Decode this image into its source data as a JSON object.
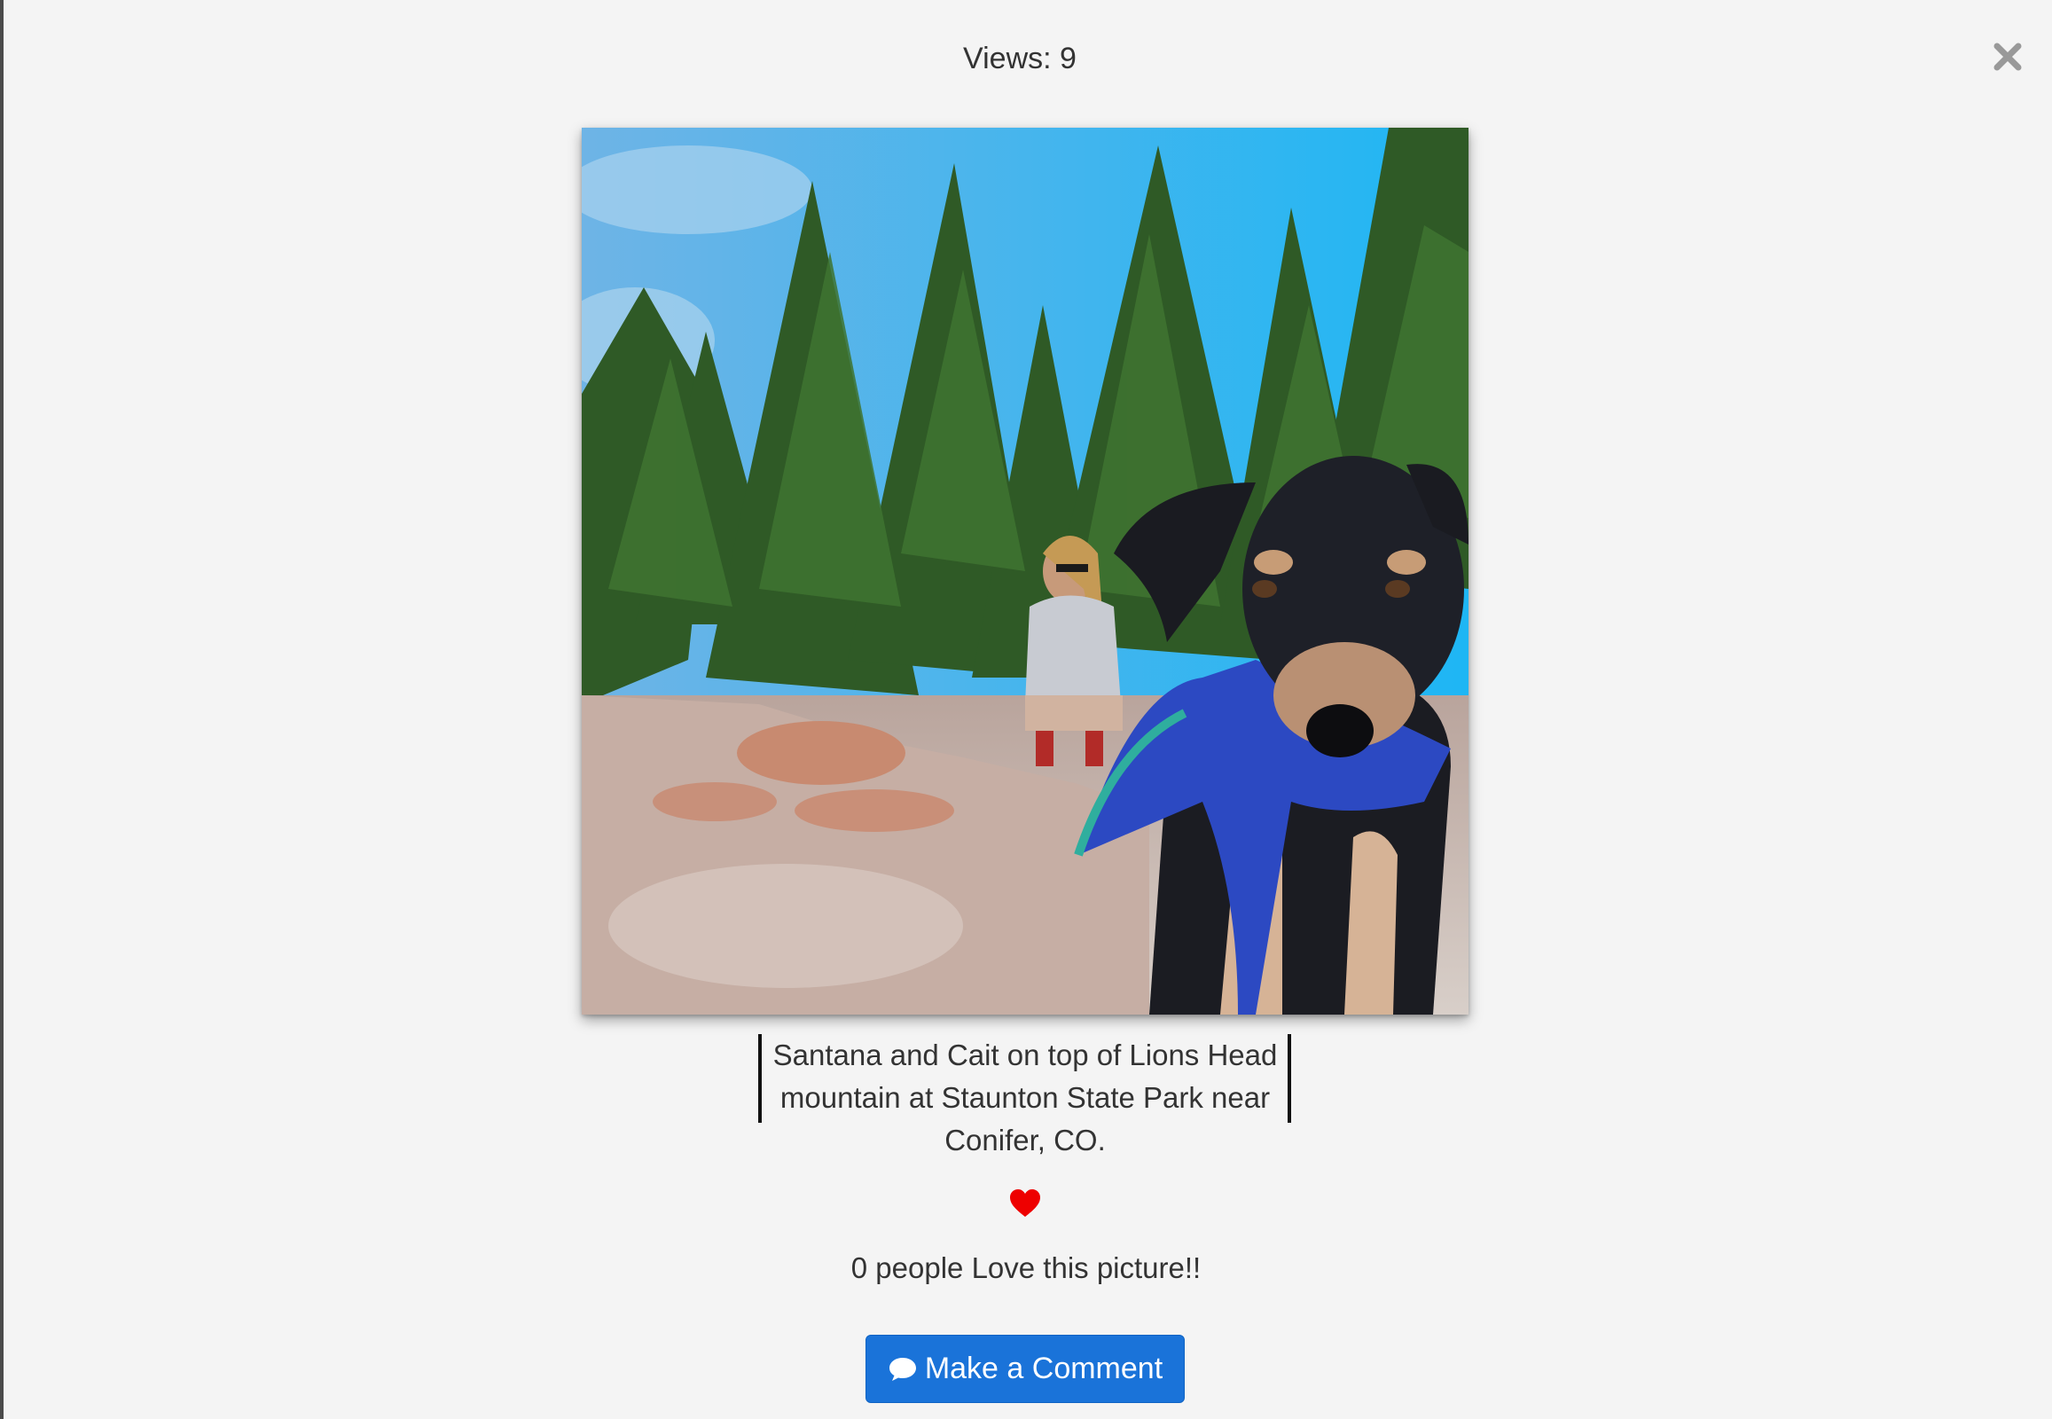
{
  "header": {
    "views_text": "Views: 9"
  },
  "photo": {
    "alt": "Dog wearing a blue bandana on rocks with a woman crouching among pine trees in the background"
  },
  "caption": {
    "text": "Santana and Cait on top of Lions Head mountain at Staunton State Park near Conifer, CO."
  },
  "love": {
    "icon": "heart-icon",
    "count_text": "0 people Love this picture!!"
  },
  "actions": {
    "comment_label": "Make a Comment",
    "comment_icon": "comment-icon"
  },
  "colors": {
    "background": "#f4f4f4",
    "button": "#1a73d9",
    "heart": "#ee0000",
    "close": "#999999"
  }
}
